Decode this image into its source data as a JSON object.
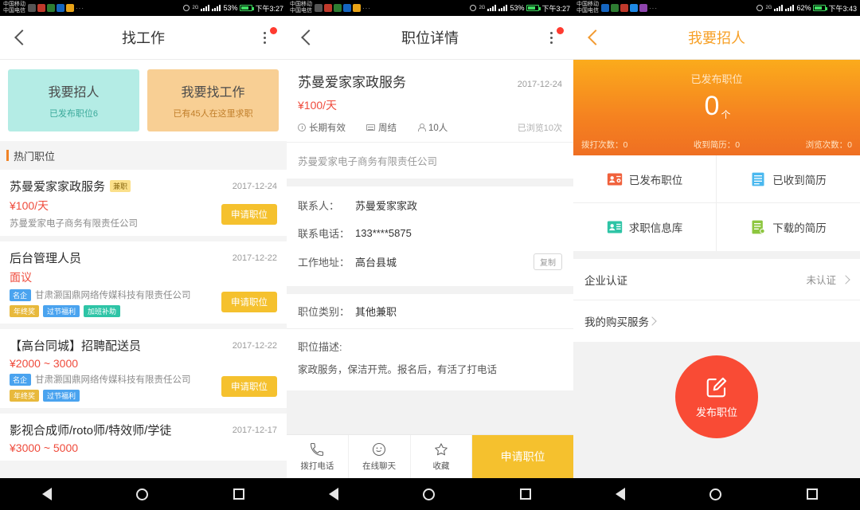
{
  "statusbars": [
    {
      "carrier1": "中国移动",
      "carrier2": "中国电信",
      "net": "2G",
      "battery": "53%",
      "time": "下午3:27",
      "dots": "···"
    },
    {
      "carrier1": "中国移动",
      "carrier2": "中国电信",
      "net": "2G",
      "battery": "53%",
      "time": "下午3:27",
      "dots": "···"
    },
    {
      "carrier1": "中国移动",
      "carrier2": "中国电信",
      "net": "2G",
      "battery": "62%",
      "time": "下午3:43",
      "dots": "···"
    }
  ],
  "panel1": {
    "nav": {
      "title": "找工作",
      "back_icon": "chevron-left-icon",
      "more_icon": "overflow-menu-icon"
    },
    "cards": [
      {
        "title": "我要招人",
        "sub": "已发布职位6",
        "color": "#b4ece5"
      },
      {
        "title": "我要找工作",
        "sub": "已有45人在这里求职",
        "color": "#f8cf94"
      }
    ],
    "section_title": "热门职位",
    "jobs": [
      {
        "title": "苏曼爱家家政服务",
        "badge": "兼职",
        "date": "2017-12-24",
        "salary": "¥100/天",
        "company": "苏曼爱家电子商务有限责任公司",
        "company_tag": "",
        "tags": [],
        "apply": "申请职位"
      },
      {
        "title": "后台管理人员",
        "badge": "",
        "date": "2017-12-22",
        "salary": "面议",
        "company": "甘肃灏国鼎网络传媒科技有限责任公司",
        "company_tag": "名企",
        "tags": [
          "年终奖",
          "过节福利",
          "加班补助"
        ],
        "apply": "申请职位"
      },
      {
        "title": "【高台同城】招聘配送员",
        "badge": "",
        "date": "2017-12-22",
        "salary": "¥2000 ~ 3000",
        "company": "甘肃灏国鼎网络传媒科技有限责任公司",
        "company_tag": "名企",
        "tags": [
          "年终奖",
          "过节福利"
        ],
        "apply": "申请职位"
      },
      {
        "title": "影视合成师/roto师/特效师/学徒",
        "badge": "",
        "date": "2017-12-17",
        "salary": "¥3000 ~ 5000",
        "company": "",
        "company_tag": "",
        "tags": [],
        "apply": ""
      }
    ]
  },
  "panel2": {
    "nav": {
      "title": "职位详情",
      "back_icon": "chevron-left-icon",
      "more_icon": "overflow-menu-icon"
    },
    "detail": {
      "title": "苏曼爱家家政服务",
      "date": "2017-12-24",
      "salary": "¥100/天",
      "meta_validity": "长期有效",
      "meta_pay_cycle": "周结",
      "meta_headcount": "10人",
      "views": "已浏览10次",
      "company": "苏曼爱家电子商务有限责任公司"
    },
    "info_rows": [
      {
        "label": "联系人：",
        "value": "苏曼爱家家政"
      },
      {
        "label": "联系电话：",
        "value": "133****5875"
      },
      {
        "label": "工作地址：",
        "value": "高台县城"
      }
    ],
    "copy_label": "复制",
    "category": {
      "label": "职位类别：",
      "value": "其他兼职"
    },
    "description": {
      "label": "职位描述:",
      "text": "家政服务，保洁开荒。报名后，有活了打电话"
    },
    "actions": [
      {
        "label": "拨打电话",
        "icon": "phone-icon"
      },
      {
        "label": "在线聊天",
        "icon": "smiley-chat-icon"
      },
      {
        "label": "收藏",
        "icon": "star-icon"
      }
    ],
    "apply_label": "申请职位"
  },
  "panel3": {
    "nav": {
      "title": "我要招人",
      "back_icon": "chevron-left-icon"
    },
    "header": {
      "label": "已发布职位",
      "count": "0",
      "unit": "个",
      "stats": [
        "拨打次数：0",
        "收到简历：0",
        "浏览次数：0"
      ]
    },
    "grid": [
      {
        "label": "已发布职位",
        "icon": "user-card-orange-icon",
        "color": "#f0613c"
      },
      {
        "label": "已收到简历",
        "icon": "document-blue-icon",
        "color": "#4ab8ef"
      },
      {
        "label": "求职信息库",
        "icon": "user-card-green-icon",
        "color": "#2ec4a6"
      },
      {
        "label": "下载的简历",
        "icon": "download-doc-green-icon",
        "color": "#8dc63f"
      }
    ],
    "rows": [
      {
        "label": "企业认证",
        "value": "未认证",
        "chevron": "chevron-right-icon"
      },
      {
        "label": "我的购买服务",
        "value": "",
        "chevron": "chevron-right-icon"
      }
    ],
    "fab": {
      "label": "发布职位",
      "icon": "edit-square-icon",
      "color": "#f94b35"
    }
  },
  "androidnav": {
    "back": "back-triangle-icon",
    "home": "home-circle-icon",
    "recents": "recents-square-icon"
  }
}
